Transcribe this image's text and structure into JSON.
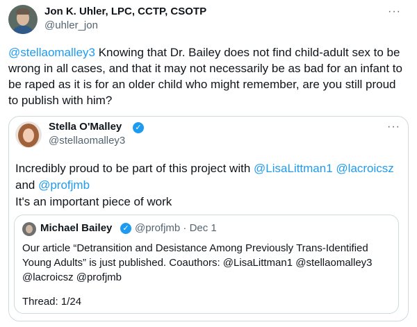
{
  "tweet": {
    "author": {
      "name": "Jon K. Uhler, LPC, CCTP, CSOTP",
      "handle": "@uhler_jon"
    },
    "more_icon": "more-dots-icon",
    "text_mention": "@stellaomalley3",
    "text_body": " Knowing that Dr. Bailey does not find child-adult sex to be wrong in all cases, and that it may not necessarily be as bad for an infant to be raped as it is for an older child who might remember, are you still proud to publish with him?"
  },
  "quote": {
    "author": {
      "name": "Stella O'Malley",
      "handle": "@stellaomalley3",
      "verified_icon": "verified-badge-icon"
    },
    "text_prefix": "Incredibly proud to be part of this project with ",
    "mention_1": "@LisaLittman1",
    "mention_2": "@lacroicsz",
    "text_and": "and ",
    "mention_3": "@profjmb",
    "text_line_3": "It's an important piece of work",
    "inner": {
      "author": {
        "name": "Michael Bailey",
        "handle": "@profjmb",
        "separator": "·",
        "date": "Dec 1",
        "verified_icon": "verified-badge-icon"
      },
      "text": "Our article “Detransition and Desistance Among Previously Trans-Identified Young Adults” is just published. Coauthors: @LisaLittman1 @stellaomalley3 @lacroicsz @profjmb",
      "thread": "Thread: 1/24"
    }
  },
  "colors": {
    "accent": "#1d9bf0",
    "text": "#0f1419",
    "muted": "#536471",
    "border": "#cfd9de"
  }
}
